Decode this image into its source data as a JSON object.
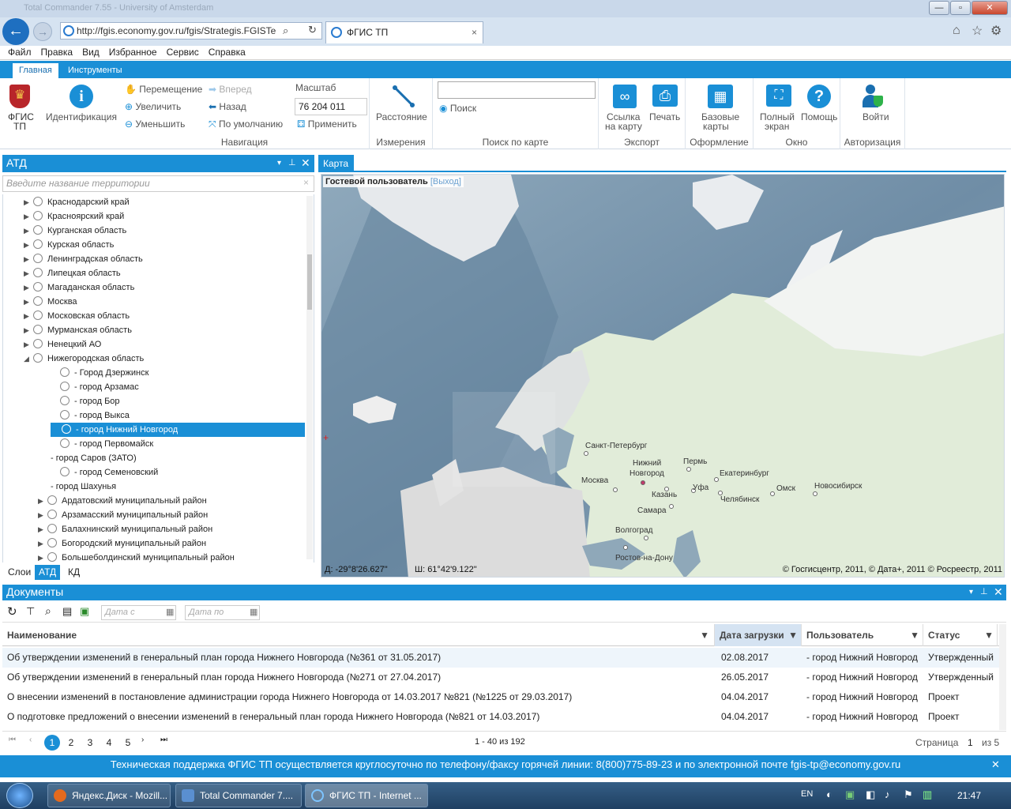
{
  "browser": {
    "title": "Total Commander 7.55 - University of Amsterdam",
    "address": "http://fgis.economy.gov.ru/fgis/Strategis.FGISTe",
    "tab_label": "ФГИС ТП",
    "minimize": "—",
    "maximize": "▫",
    "close": "✕"
  },
  "menu": [
    "Файл",
    "Правка",
    "Вид",
    "Избранное",
    "Сервис",
    "Справка"
  ],
  "ribbon": {
    "tabs": [
      "Главная",
      "Инструменты"
    ],
    "logo_label1": "ФГИС",
    "logo_label2": "ТП",
    "identify": "Идентификация",
    "nav": {
      "move": "Перемещение",
      "zoom_in": "Увеличить",
      "zoom_out": "Уменьшить",
      "forward": "Вперед",
      "back": "Назад",
      "default": "По умолчанию",
      "scale_label": "Масштаб",
      "scale_value": "76 204 011",
      "apply": "Применить",
      "group": "Навигация"
    },
    "measure": {
      "distance": "Расстояние",
      "group": "Измерения"
    },
    "search": {
      "button": "Поиск",
      "group": "Поиск по карте",
      "value": ""
    },
    "export": {
      "link1": "Ссылка",
      "link2": "на карту",
      "print": "Печать",
      "group": "Экспорт"
    },
    "design": {
      "base1": "Базовые",
      "base2": "карты",
      "group": "Оформление"
    },
    "window": {
      "full1": "Полный",
      "full2": "экран",
      "help": "Помощь",
      "group": "Окно"
    },
    "auth": {
      "login": "Войти",
      "group": "Авторизация"
    }
  },
  "atd": {
    "title": "АТД",
    "search_placeholder": "Введите название территории",
    "items": [
      {
        "label": "Краснодарский край",
        "level": 0,
        "expand": "▶",
        "node": true
      },
      {
        "label": "Красноярский край",
        "level": 0,
        "expand": "▶",
        "node": true
      },
      {
        "label": "Курганская область",
        "level": 0,
        "expand": "▶",
        "node": true
      },
      {
        "label": "Курская область",
        "level": 0,
        "expand": "▶",
        "node": true
      },
      {
        "label": "Ленинградская область",
        "level": 0,
        "expand": "▶",
        "node": true
      },
      {
        "label": "Липецкая область",
        "level": 0,
        "expand": "▶",
        "node": true
      },
      {
        "label": "Магаданская область",
        "level": 0,
        "expand": "▶",
        "node": true
      },
      {
        "label": "Москва",
        "level": 0,
        "expand": "▶",
        "node": true
      },
      {
        "label": "Московская область",
        "level": 0,
        "expand": "▶",
        "node": true
      },
      {
        "label": "Мурманская область",
        "level": 0,
        "expand": "▶",
        "node": true
      },
      {
        "label": "Ненецкий АО",
        "level": 0,
        "expand": "▶",
        "node": true
      },
      {
        "label": "Нижегородская область",
        "level": 0,
        "expand": "◢",
        "node": true
      },
      {
        "label": "- Город Дзержинск",
        "level": 1,
        "expand": "",
        "node": true
      },
      {
        "label": "- город Арзамас",
        "level": 1,
        "expand": "",
        "node": true
      },
      {
        "label": "- город Бор",
        "level": 1,
        "expand": "",
        "node": true
      },
      {
        "label": "- город Выкса",
        "level": 1,
        "expand": "",
        "node": true
      },
      {
        "label": "- город Нижний Новгород",
        "level": 1,
        "expand": "",
        "node": true,
        "selected": true
      },
      {
        "label": "- город Первомайск",
        "level": 1,
        "expand": "",
        "node": true
      },
      {
        "label": "- город Саров (ЗАТО)",
        "level": 1,
        "expand": "",
        "node": false
      },
      {
        "label": "- город Семеновский",
        "level": 1,
        "expand": "",
        "node": true
      },
      {
        "label": "- город Шахунья",
        "level": 1,
        "expand": "",
        "node": false
      },
      {
        "label": "Ардатовский муниципальный район",
        "level": 1,
        "expand": "▶",
        "node": true
      },
      {
        "label": "Арзамасский муниципальный район",
        "level": 1,
        "expand": "▶",
        "node": true
      },
      {
        "label": "Балахнинский муниципальный район",
        "level": 1,
        "expand": "▶",
        "node": true
      },
      {
        "label": "Богородский муниципальный район",
        "level": 1,
        "expand": "▶",
        "node": true
      },
      {
        "label": "Большеболдинский муниципальный район",
        "level": 1,
        "expand": "▶",
        "node": true
      }
    ],
    "bottom_tabs": [
      "Слои",
      "АТД",
      "КД"
    ]
  },
  "map": {
    "tab": "Карта",
    "guest": "Гостевой пользователь",
    "exit": "[Выход]",
    "coord_lon": "Д: -29°8'26.627\"",
    "coord_lat": "Ш: 61°42'9.122\"",
    "copyright": "© Госгисцентр, 2011, © Дата+, 2011 © Росреестр, 2011",
    "cities": [
      {
        "name": "Санкт-Петербург"
      },
      {
        "name": "Нижний"
      },
      {
        "name": "Новгород"
      },
      {
        "name": "Пермь"
      },
      {
        "name": "Екатеринбург"
      },
      {
        "name": "Москва"
      },
      {
        "name": "Казань"
      },
      {
        "name": "Уфа"
      },
      {
        "name": "Омск"
      },
      {
        "name": "Новосибирск"
      },
      {
        "name": "Челябинск"
      },
      {
        "name": "Самара"
      },
      {
        "name": "Волгоград"
      },
      {
        "name": "Ростов-на-Дону"
      }
    ]
  },
  "documents": {
    "title": "Документы",
    "date_from": "Дата с",
    "date_to": "Дата по",
    "columns": [
      "Наименование",
      "Дата загрузки",
      "Пользователь",
      "Статус"
    ],
    "rows": [
      {
        "name": "Об утверждении изменений в генеральный план города Нижнего Новгорода (№361 от 31.05.2017)",
        "date": "02.08.2017",
        "user": "- город Нижний Новгород",
        "status": "Утвержденный"
      },
      {
        "name": "Об утверждении изменений в генеральный план города Нижнего Новгорода (№271 от 27.04.2017)",
        "date": "26.05.2017",
        "user": "- город Нижний Новгород",
        "status": "Утвержденный"
      },
      {
        "name": "О внесении изменений в постановление администрации города Нижнего Новгорода от 14.03.2017 №821 (№1225 от 29.03.2017)",
        "date": "04.04.2017",
        "user": "- город Нижний Новгород",
        "status": "Проект"
      },
      {
        "name": "О подготовке предложений о внесении изменений в генеральный план города Нижнего Новгорода (№821 от 14.03.2017)",
        "date": "04.04.2017",
        "user": "- город Нижний Новгород",
        "status": "Проект"
      }
    ],
    "pager": {
      "pages": [
        "1",
        "2",
        "3",
        "4",
        "5"
      ],
      "range": "1 - 40 из 192",
      "page_label": "Страница",
      "page_value": "1",
      "of": "из 5"
    }
  },
  "support": "Техническая поддержка ФГИС ТП осуществляется круглосуточно по телефону/факсу горячей линии: 8(800)775-89-23 и по электронной почте fgis-tp@economy.gov.ru",
  "taskbar": {
    "tasks": [
      "Яндекс.Диск - Mozill...",
      "Total Commander 7....",
      "ФГИС ТП - Internet ..."
    ],
    "lang": "EN",
    "time": "21:47"
  }
}
